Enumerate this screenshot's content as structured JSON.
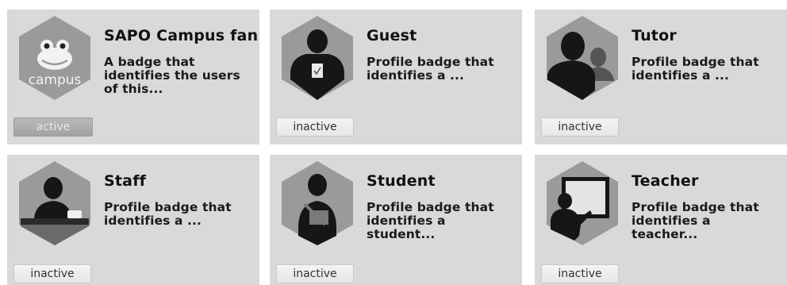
{
  "badges": [
    {
      "title": "SAPO Campus fan",
      "description": "A badge that identifies the users of this...",
      "status": "active",
      "icon": "campus-logo-icon",
      "logo_text": "campus"
    },
    {
      "title": "Guest",
      "description": "Profile badge that identifies a ...",
      "status": "inactive",
      "icon": "guest-person-icon"
    },
    {
      "title": "Tutor",
      "description": "Profile badge that identifies a ...",
      "status": "inactive",
      "icon": "tutor-people-icon"
    },
    {
      "title": "Staff",
      "description": "Profile badge that identifies a ...",
      "status": "inactive",
      "icon": "staff-person-icon"
    },
    {
      "title": "Student",
      "description": "Profile badge that identifies a student...",
      "status": "inactive",
      "icon": "student-person-icon"
    },
    {
      "title": "Teacher",
      "description": "Profile badge that identifies a teacher...",
      "status": "inactive",
      "icon": "teacher-board-icon"
    }
  ],
  "colors": {
    "card_bg": "#d9d9d9",
    "hex_fill": "#9a9a9a",
    "silhouette": "#161616"
  }
}
